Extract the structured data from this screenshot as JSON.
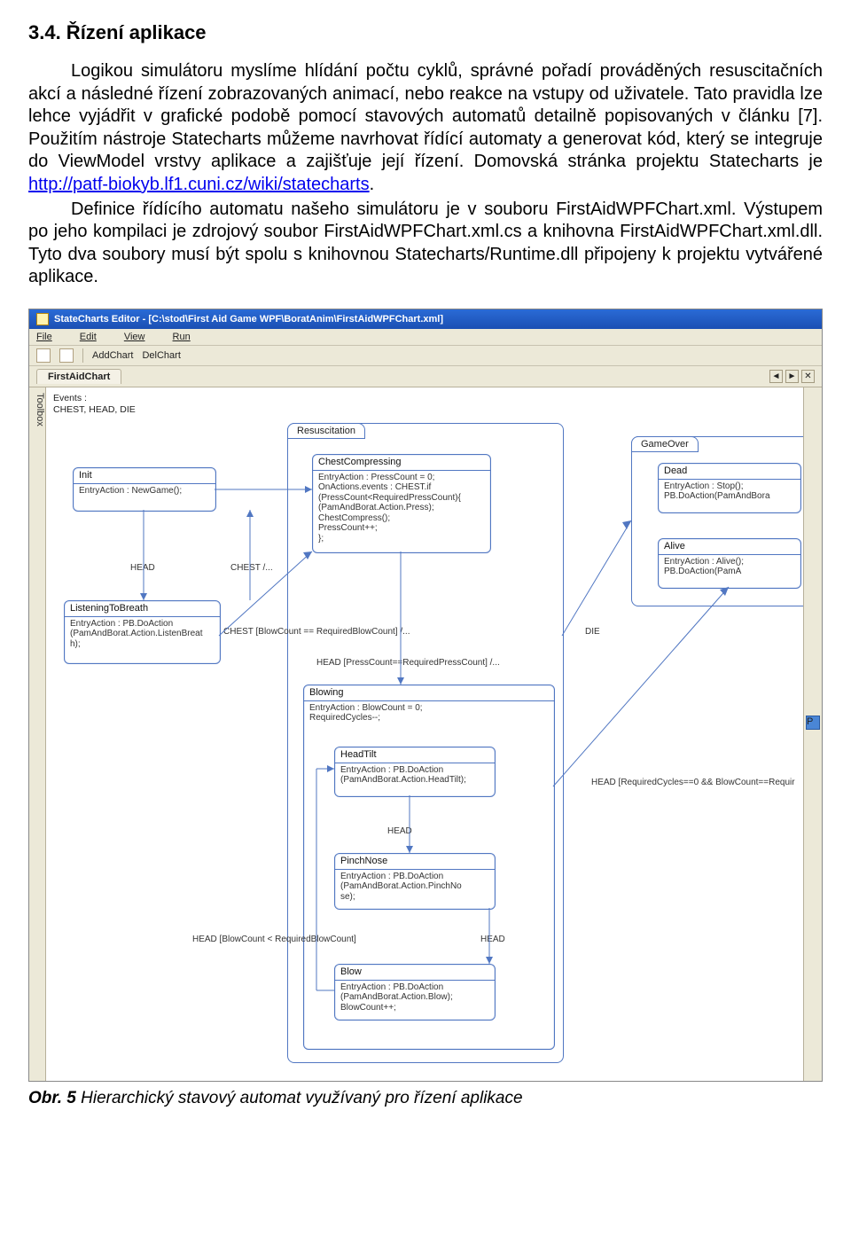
{
  "section": {
    "heading": "3.4. Řízení aplikace",
    "para1": "Logikou simulátoru myslíme hlídání počtu cyklů, správné pořadí prováděných resuscitačních akcí a následné řízení zobrazovaných animací, nebo reakce na vstupy od uživatele. Tato pravidla lze lehce vyjádřit v grafické podobě pomocí stavových automatů detailně popisovaných v článku [7]. Použitím nástroje Statecharts můžeme navrhovat řídící automaty a generovat kód, který se integruje do ViewModel vrstvy aplikace a zajišťuje její řízení. Domovská stránka projektu Statecharts je ",
    "link_text": "http://patf-biokyb.lf1.cuni.cz/wiki/statecharts",
    "para1_tail": ".",
    "para2": "Definice řídícího automatu našeho simulátoru je v souboru FirstAidWPFChart.xml. Výstupem po jeho kompilaci je zdrojový soubor FirstAidWPFChart.xml.cs a knihovna FirstAidWPFChart.xml.dll. Tyto dva soubory musí být spolu s knihovnou Statecharts/Runtime.dll připojeny k projektu vytvářené aplikace."
  },
  "editor": {
    "title": "StateCharts Editor - [C:\\stod\\First Aid Game WPF\\BoratAnim\\FirstAidWPFChart.xml]",
    "menu": {
      "file": "File",
      "edit": "Edit",
      "view": "View",
      "run": "Run"
    },
    "toolbar": {
      "addchart": "AddChart",
      "delchart": "DelChart"
    },
    "tab": "FirstAidChart",
    "sidetab": "Toolbox",
    "events_label": "Events :",
    "events_list": "CHEST, HEAD, DIE",
    "outer": {
      "resuscitation": "Resuscitation",
      "gameover": "GameOver"
    },
    "states": {
      "init": {
        "name": "Init",
        "body": "EntryAction : NewGame();"
      },
      "chest": {
        "name": "ChestCompressing",
        "body": "EntryAction : PressCount = 0;\nOnActions.events : CHEST.if\n(PressCount<RequiredPressCount){\n(PamAndBorat.Action.Press);\n ChestCompress();\n PressCount++;\n};"
      },
      "dead": {
        "name": "Dead",
        "body": "EntryAction : Stop();\nPB.DoAction(PamAndBora"
      },
      "alive": {
        "name": "Alive",
        "body": "EntryAction : Alive();\nPB.DoAction(PamA"
      },
      "listen": {
        "name": "ListeningToBreath",
        "body": "EntryAction : PB.DoAction\n(PamAndBorat.Action.ListenBreat\nh);"
      },
      "blowing": {
        "name": "Blowing",
        "body": "EntryAction : BlowCount = 0;\nRequiredCycles--;"
      },
      "headtilt": {
        "name": "HeadTilt",
        "body": "EntryAction : PB.DoAction\n(PamAndBorat.Action.HeadTilt);"
      },
      "pinch": {
        "name": "PinchNose",
        "body": "EntryAction : PB.DoAction\n(PamAndBorat.Action.PinchNo\nse);"
      },
      "blow": {
        "name": "Blow",
        "body": "EntryAction : PB.DoAction\n(PamAndBorat.Action.Blow);\nBlowCount++;"
      }
    },
    "labels": {
      "l_head1": "HEAD",
      "l_chest1": "CHEST /...",
      "l_chest2": "CHEST [BlowCount == RequiredBlowCount] /...",
      "l_head2": "HEAD [PressCount==RequiredPressCount] /...",
      "l_die": "DIE",
      "l_headreq": "HEAD [RequiredCycles==0 && BlowCount==Requir",
      "l_head3": "HEAD",
      "l_head4": "HEAD",
      "l_headblow": "HEAD [BlowCount < RequiredBlowCount]"
    }
  },
  "caption": {
    "ref": "Obr. 5",
    "text": " Hierarchický stavový automat využívaný pro řízení aplikace"
  }
}
